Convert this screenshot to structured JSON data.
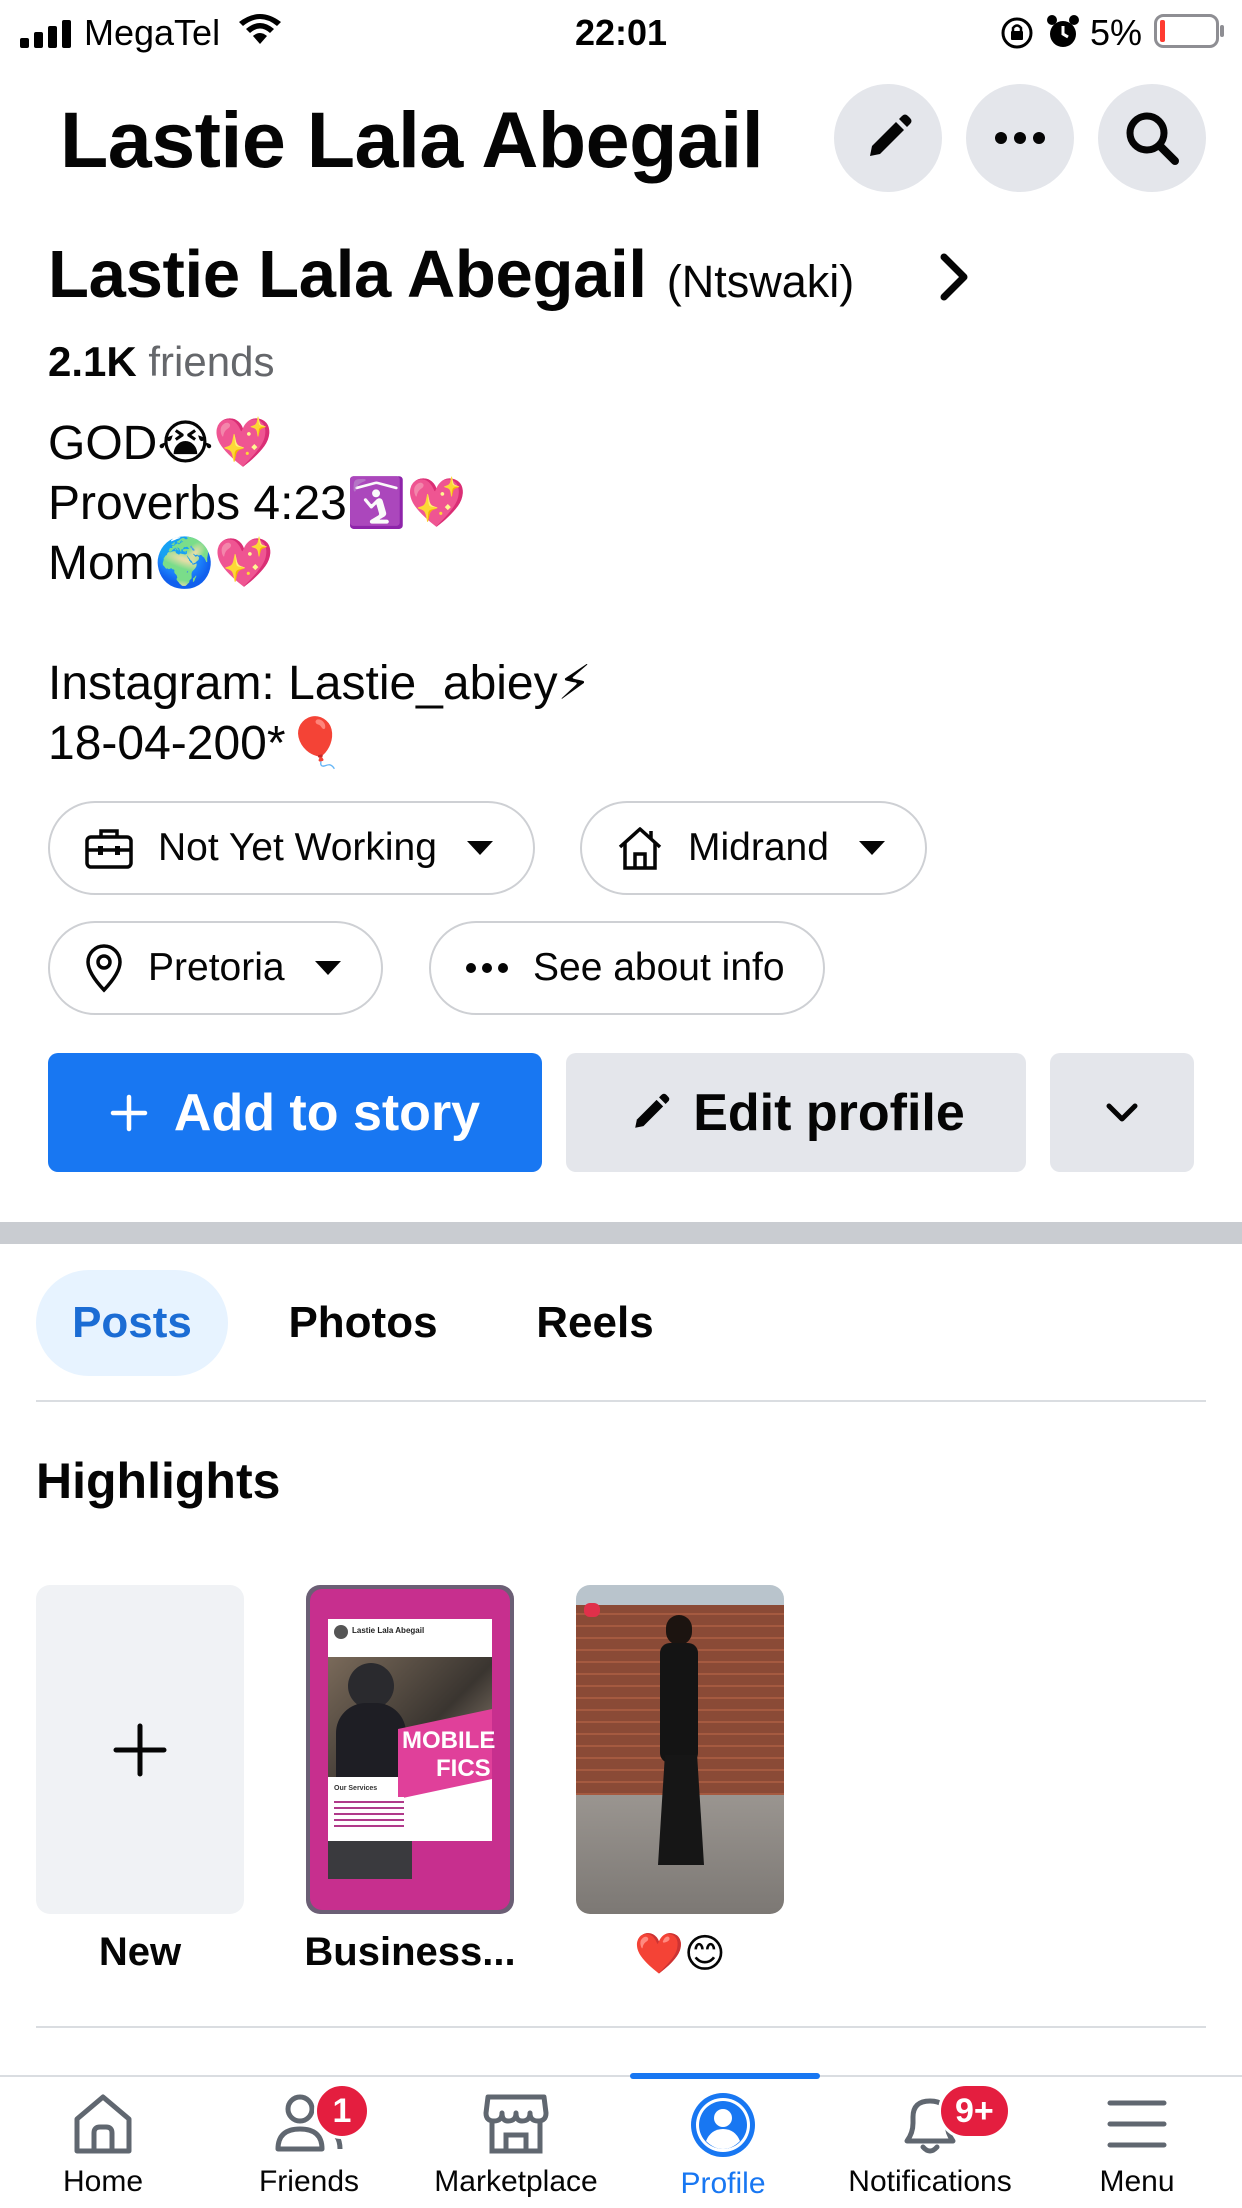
{
  "status_bar": {
    "carrier": "MegaTel",
    "time": "22:01",
    "battery": "5%"
  },
  "header": {
    "title": "Lastie Lala Abegail",
    "icons": [
      "pencil-icon",
      "more-icon",
      "search-icon"
    ]
  },
  "profile": {
    "name": "Lastie Lala Abegail",
    "alt_name": "(Ntswaki)",
    "friends_count": "2.1K",
    "friends_label": "friends",
    "bio_lines": [
      "GOD😭💖",
      "Proverbs 4:23🛐💖",
      "Mom🌍💖",
      "",
      "Instagram: Lastie_abiey⚡",
      "18-04-200*🎈"
    ]
  },
  "details": {
    "work": "Not Yet Working",
    "home": "Midrand",
    "location": "Pretoria",
    "about": "See about info"
  },
  "actions": {
    "add_story": "Add to story",
    "edit_profile": "Edit profile"
  },
  "tabs": [
    {
      "label": "Posts",
      "active": true
    },
    {
      "label": "Photos",
      "active": false
    },
    {
      "label": "Reels",
      "active": false
    }
  ],
  "highlights": {
    "title": "Highlights",
    "items": [
      {
        "label": "New"
      },
      {
        "label": "Business..."
      },
      {
        "label": "❤️😊"
      }
    ],
    "card_texts": {
      "poster_name": "Lastie Lala Abegail",
      "mobile": "MOBILE",
      "fics": "FICS",
      "services": "Our Services"
    }
  },
  "tab_bar": {
    "items": [
      {
        "label": "Home",
        "icon": "home-icon"
      },
      {
        "label": "Friends",
        "icon": "friends-icon",
        "badge": "1"
      },
      {
        "label": "Marketplace",
        "icon": "marketplace-icon"
      },
      {
        "label": "Profile",
        "icon": "profile-icon",
        "active": true
      },
      {
        "label": "Notifications",
        "icon": "bell-icon",
        "badge": "9+"
      },
      {
        "label": "Menu",
        "icon": "menu-icon"
      }
    ]
  },
  "colors": {
    "accent": "#1877f2",
    "badge": "#e41e3f",
    "button_gray": "#e4e6eb"
  }
}
